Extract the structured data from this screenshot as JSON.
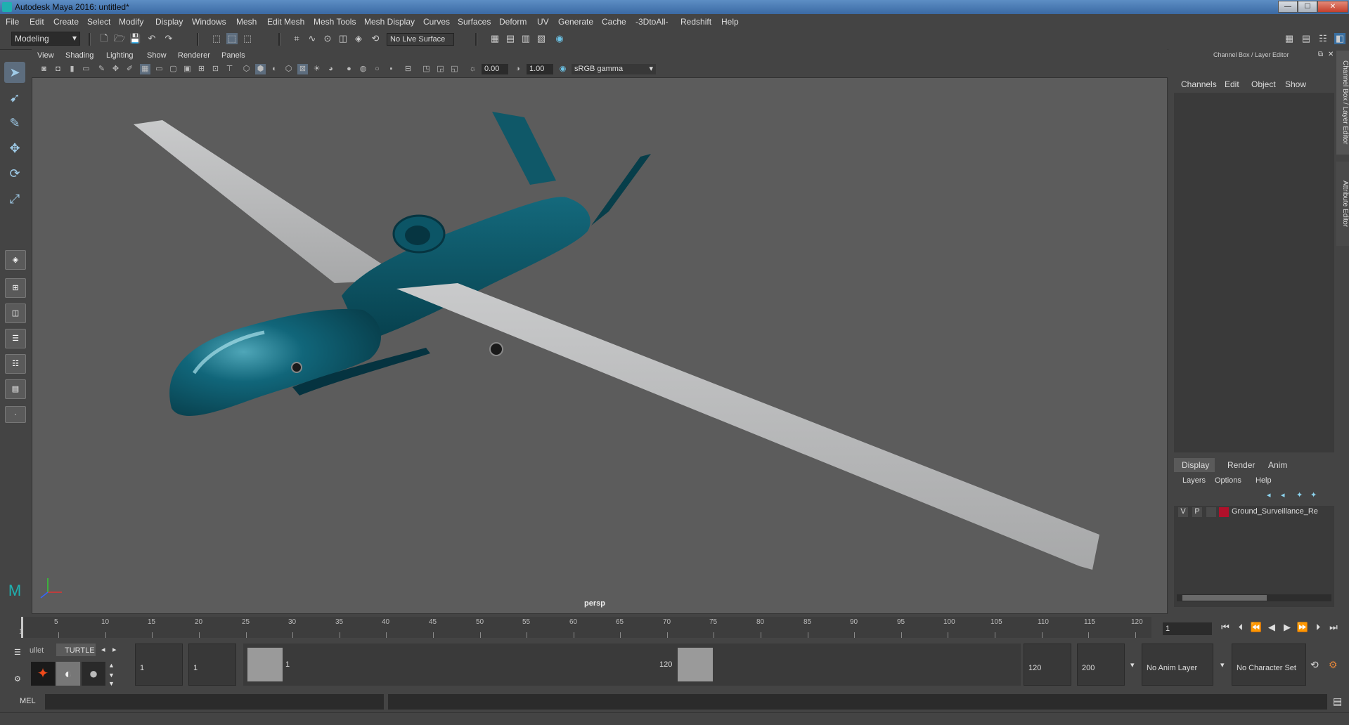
{
  "window": {
    "title": "Autodesk Maya 2016: untitled*",
    "min": "—",
    "max": "☐",
    "close": "✕"
  },
  "menus": [
    "File",
    "Edit",
    "Create",
    "Select",
    "Modify",
    "Display",
    "Windows",
    "Mesh",
    "Edit Mesh",
    "Mesh Tools",
    "Mesh Display",
    "Curves",
    "Surfaces",
    "Deform",
    "UV",
    "Generate",
    "Cache",
    "-3DtoAll-",
    "Redshift",
    "Help"
  ],
  "shelf": {
    "mode": "Modeling",
    "live_surface": "No Live Surface"
  },
  "viewport": {
    "menus": [
      "View",
      "Shading",
      "Lighting",
      "Show",
      "Renderer",
      "Panels"
    ],
    "field_a": "0.00",
    "field_b": "1.00",
    "color_space": "sRGB gamma",
    "camera": "persp",
    "colors": {
      "body": "#0e5a6b",
      "wing": "#b7b8b9",
      "bg": "#5c5c5c"
    }
  },
  "channel_box": {
    "title": "Channel Box / Layer Editor",
    "tabs": [
      "Channels",
      "Edit",
      "Object",
      "Show"
    ],
    "side_tabs": [
      "Channel Box / Layer Editor",
      "Attribute Editor"
    ]
  },
  "layer_editor": {
    "tabs": [
      "Display",
      "Render",
      "Anim"
    ],
    "menus": [
      "Layers",
      "Options",
      "Help"
    ],
    "layer": {
      "v": "V",
      "p": "P",
      "name": "Ground_Surveillance_Re",
      "color": "#b0102a"
    }
  },
  "timeline": {
    "ticks": [
      5,
      10,
      15,
      20,
      25,
      30,
      35,
      40,
      45,
      50,
      55,
      60,
      65,
      70,
      75,
      80,
      85,
      90,
      95,
      100,
      105,
      110,
      115,
      120
    ],
    "start_label": "1",
    "current_frame": "1"
  },
  "range": {
    "shelf_tabs": [
      "ullet",
      "TURTLE"
    ],
    "start_a": "1",
    "start_b": "1",
    "range_start": "1",
    "range_end": "120",
    "end_a": "120",
    "end_b": "200",
    "anim_layer": "No Anim Layer",
    "char_set": "No Character Set"
  },
  "cmd": {
    "label": "MEL"
  }
}
